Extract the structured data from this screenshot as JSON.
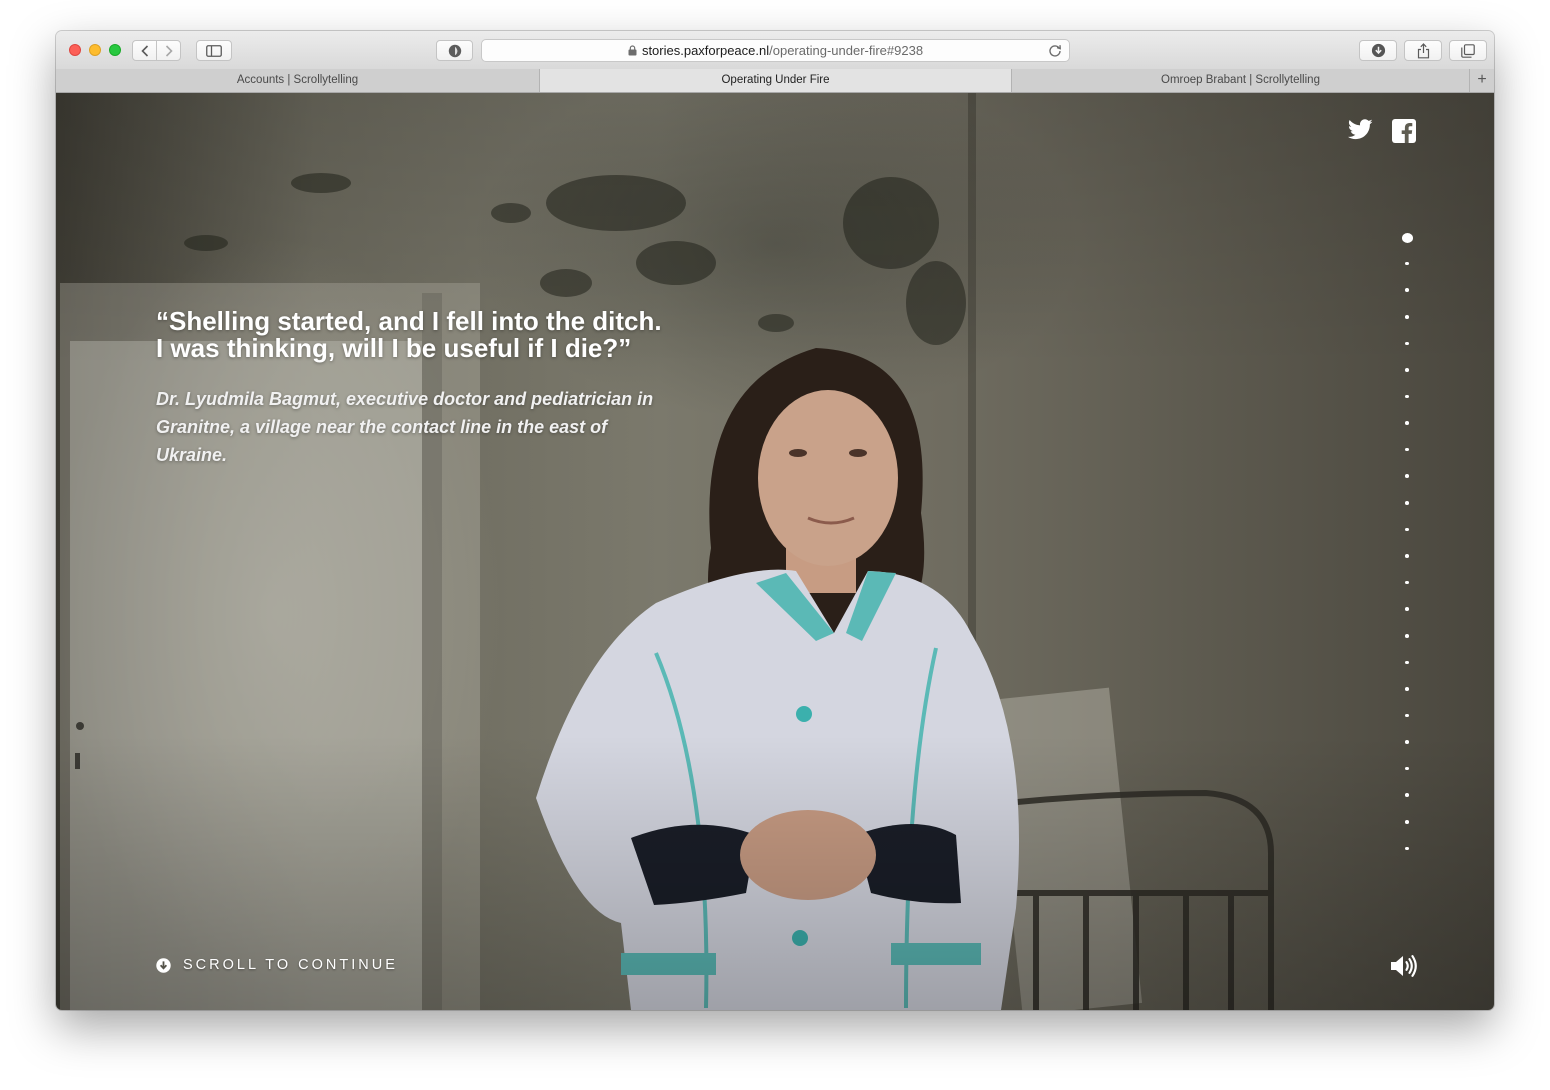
{
  "browser": {
    "url_domain": "stories.paxforpeace.nl",
    "url_path": "/operating-under-fire#9238",
    "tabs": [
      {
        "label": "Accounts | Scrollytelling",
        "active": false
      },
      {
        "label": "Operating Under Fire",
        "active": true
      },
      {
        "label": "Omroep Brabant | Scrollytelling",
        "active": false
      }
    ],
    "new_tab_label": "+"
  },
  "story": {
    "quote": "“Shelling started, and I fell into the ditch. I was thinking, will I be useful if I die?”",
    "caption": "Dr. Lyudmila Bagmut, executive doctor and pediatrician in Granitne, a village near the contact line in the east of Ukraine.",
    "scroll_cta": "SCROLL TO CONTINUE",
    "chapter_count": 24,
    "active_chapter": 1
  },
  "icons": {
    "social": [
      "twitter-icon",
      "facebook-icon"
    ],
    "sound": "speaker-icon",
    "scroll": "arrow-down-circle-icon"
  },
  "colors": {
    "overlay_text": "#ffffff",
    "traffic_red": "#fc5f57",
    "traffic_yellow": "#fdbc2e",
    "traffic_green": "#28c840"
  }
}
